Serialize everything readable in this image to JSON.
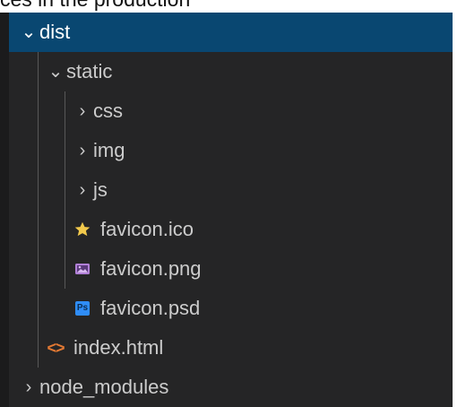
{
  "partial_header": {
    "text": "ces in the production"
  },
  "explorer": {
    "items": [
      {
        "label": "dist",
        "state": "expanded",
        "selected": true
      },
      {
        "label": "static",
        "state": "expanded",
        "selected": false
      },
      {
        "label": "css",
        "state": "collapsed",
        "selected": false
      },
      {
        "label": "img",
        "state": "collapsed",
        "selected": false
      },
      {
        "label": "js",
        "state": "collapsed",
        "selected": false
      },
      {
        "label": "favicon.ico",
        "type": "file",
        "icon": "star-icon",
        "selected": false
      },
      {
        "label": "favicon.png",
        "type": "file",
        "icon": "image-icon",
        "selected": false
      },
      {
        "label": "favicon.psd",
        "type": "file",
        "icon": "photoshop-icon",
        "icon_text": "Ps",
        "selected": false
      },
      {
        "label": "index.html",
        "type": "file",
        "icon": "html-icon",
        "icon_text": "<>",
        "selected": false
      },
      {
        "label": "node_modules",
        "state": "collapsed",
        "selected": false
      }
    ]
  },
  "colors": {
    "sidebar_background": "#252526",
    "selection_background": "#094771",
    "text": "#cccccc",
    "selected_text": "#ffffff",
    "favicon_ico_star": "#f2c94c",
    "favicon_png_image": "#b180d7",
    "favicon_psd_badge": "#2f8df8",
    "index_html_icon": "#e37933"
  }
}
